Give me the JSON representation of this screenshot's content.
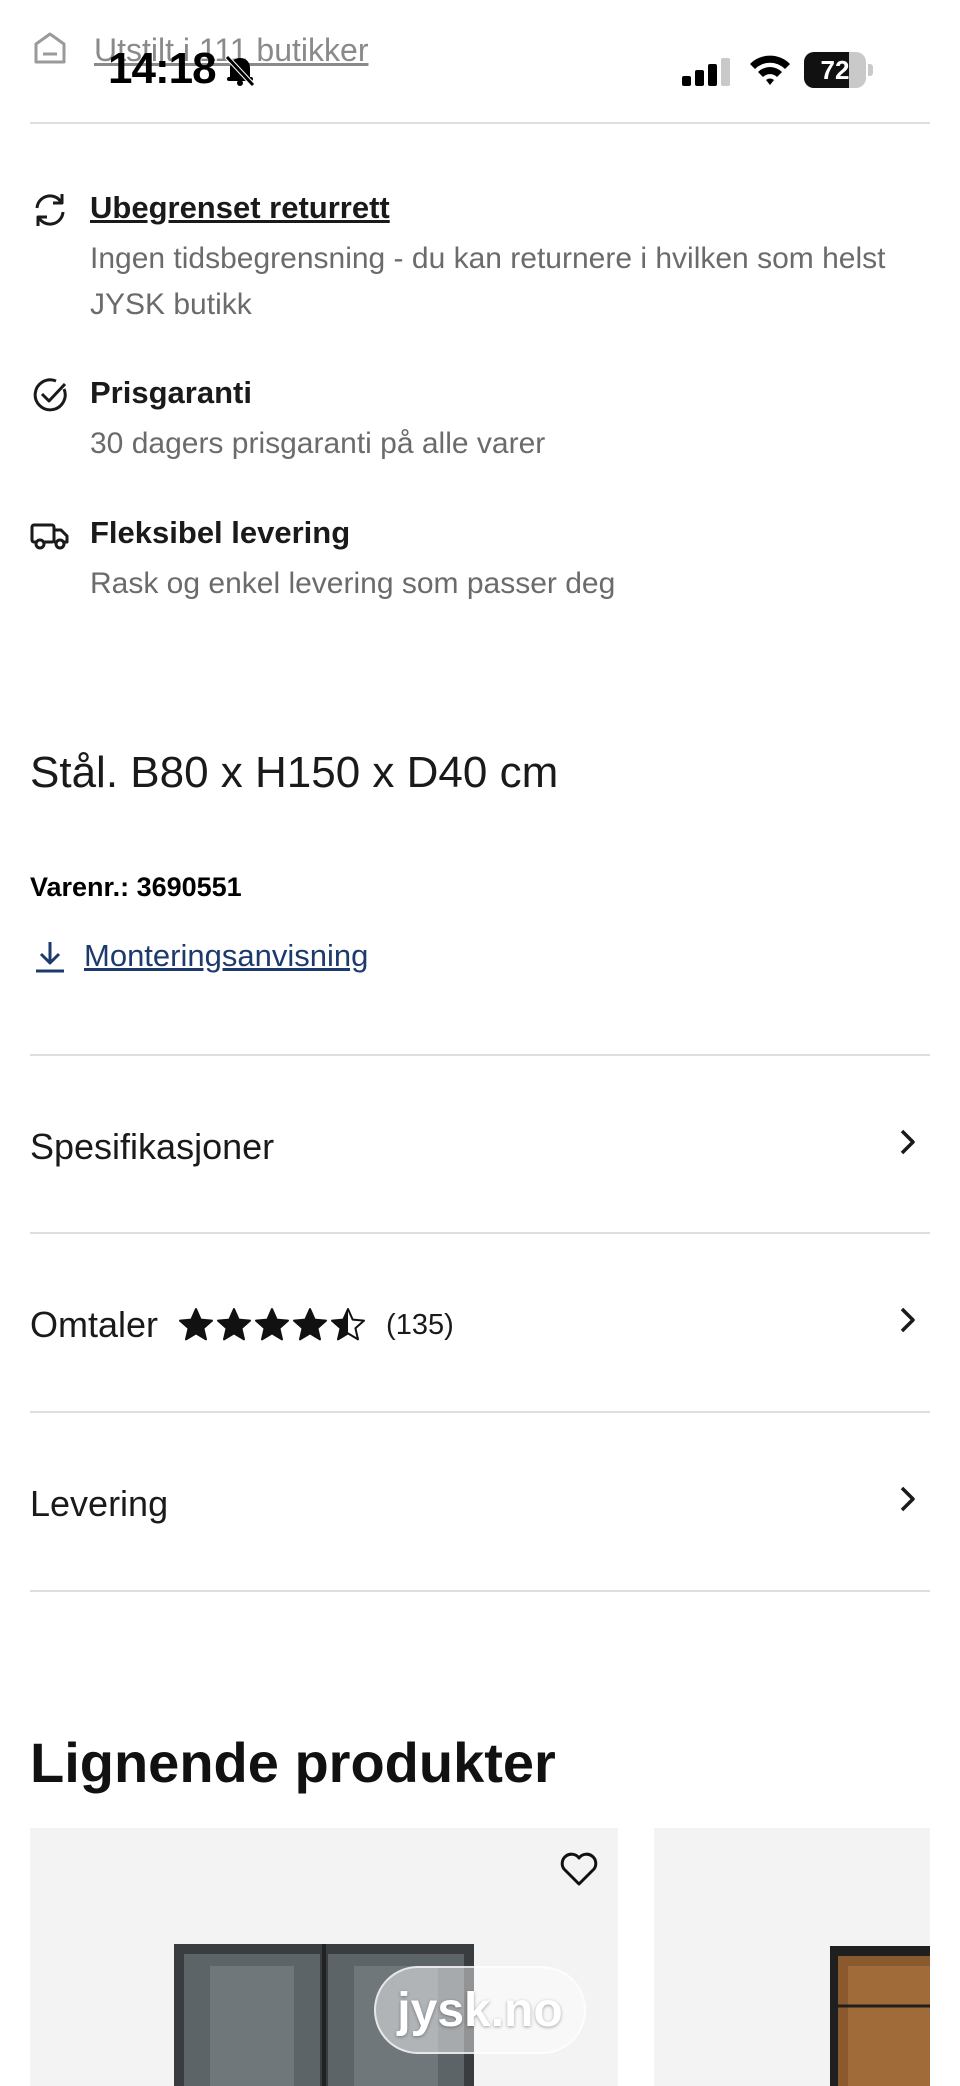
{
  "status_bar": {
    "time": "14:18",
    "battery_percent": "72",
    "battery_level": 0.72
  },
  "stock": {
    "link": "Utstilt i 111 butikker"
  },
  "usps": [
    {
      "title": "Ubegrenset returrett",
      "desc": "Ingen tidsbegrensning - du kan returnere i hvilken som helst JYSK butikk",
      "icon": "refresh-icon"
    },
    {
      "title": "Prisgaranti",
      "desc": "30 dagers prisgaranti på alle varer",
      "icon": "check-circle-icon"
    },
    {
      "title": "Fleksibel levering",
      "desc": "Rask og enkel levering som passer deg",
      "icon": "truck-icon"
    }
  ],
  "product": {
    "dimensions": "Stål. B80 x H150 x D40 cm",
    "item_number": "Varenr.: 3690551",
    "manual_link": "Monteringsanvisning"
  },
  "accordion": {
    "specs": "Spesifikasjoner",
    "reviews": "Omtaler",
    "review_count": "(135)",
    "rating": 4.5,
    "delivery": "Levering"
  },
  "similar": {
    "title": "Lignende produkter"
  },
  "watermark": "jysk.no",
  "colors": {
    "link": "#1d3a6d",
    "muted": "#6b6b6b",
    "divider": "#dedede",
    "card_bg": "#f3f3f3"
  }
}
